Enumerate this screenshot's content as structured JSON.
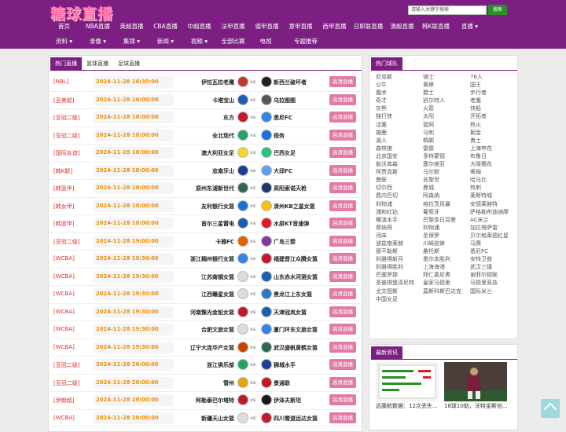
{
  "header": {
    "logo": "糖球直播",
    "search_placeholder": "请输入关键字搜索",
    "search_button": "搜索"
  },
  "nav1": [
    "首页",
    "NBA直播",
    "英超直播",
    "CBA直播",
    "中超直播",
    "法甲直播",
    "德甲直播",
    "意甲直播",
    "西甲直播",
    "日职联直播",
    "澳超直播",
    "韩K联直播",
    "直播 ▾"
  ],
  "nav2": [
    "资料 ▾",
    "录像 ▾",
    "集锦 ▾",
    "新闻 ▾",
    "视频 ▾",
    "全部比赛",
    "电视",
    "专题推荐"
  ],
  "tabs": [
    "热门直播",
    "篮球直播",
    "足球直播"
  ],
  "live_label": "高清直播",
  "vs": "vs",
  "matches": [
    {
      "league": "[NBL]",
      "time": "2024-11-28 16:30:00",
      "home": "伊拉瓦拉老鹰",
      "away": "新西兰破坏者",
      "hc": "#c0392b",
      "ac": "#222"
    },
    {
      "league": "[亚美超]",
      "time": "2024-11-28 16:00:00",
      "home": "卡塔宝山",
      "away": "乌拉图图",
      "hc": "#1a5fb4",
      "ac": "#555"
    },
    {
      "league": "[亚冠二级]",
      "time": "2024-11-28 18:00:00",
      "home": "东方",
      "away": "悉尼FC",
      "hc": "#c01c28",
      "ac": "#3584e4"
    },
    {
      "league": "[亚冠二级]",
      "time": "2024-11-28 18:00:00",
      "home": "全北现代",
      "away": "宿务",
      "hc": "#26a269",
      "ac": "#1c71d8"
    },
    {
      "league": "[国际友谊]",
      "time": "2024-11-28 18:00:00",
      "home": "澳大利亚女足",
      "away": "巴西女足",
      "hc": "#f6d32d",
      "ac": "#2ec27e"
    },
    {
      "league": "[韩K联]",
      "time": "2024-11-28 18:00:00",
      "home": "忠南牙山",
      "away": "大邱FC",
      "hc": "#1c3f94",
      "ac": "#62a0ea"
    },
    {
      "league": "[韩篮甲]",
      "time": "2024-11-28 18:00:00",
      "home": "原州东浦新世代",
      "away": "高阳索诺天枪",
      "hc": "#2d6a4f",
      "ac": "#1a3a6b"
    },
    {
      "league": "[韩女甲]",
      "time": "2024-11-28 18:00:00",
      "home": "友利银行女篮",
      "away": "清州KB之星女篮",
      "hc": "#1c71d8",
      "ac": "#f5c211"
    },
    {
      "league": "[韩篮甲]",
      "time": "2024-11-28 18:00:00",
      "home": "首尔三星雷电",
      "away": "水原KT音速弹",
      "hc": "#1a5fb4",
      "ac": "#e01b24"
    },
    {
      "league": "[亚冠二级]",
      "time": "2024-11-28 19:00:00",
      "home": "卡雅FC",
      "away": "广岛三箭",
      "hc": "#e66100",
      "ac": "#813d9c"
    },
    {
      "league": "[WCBA]",
      "time": "2024-11-28 19:30:00",
      "home": "浙江稠州银行女篮",
      "away": "福建晋江众腾女篮",
      "hc": "#3584e4",
      "ac": "#c01c28"
    },
    {
      "league": "[WCBA]",
      "time": "2024-11-28 19:30:00",
      "home": "江苏南钢女篮",
      "away": "山东赤水河酒女篮",
      "hc": "#dddddd",
      "ac": "#1a5fb4"
    },
    {
      "league": "[WCBA]",
      "time": "2024-11-28 19:30:00",
      "home": "江西赣星女篮",
      "away": "黑龙江上东女篮",
      "hc": "#dddddd",
      "ac": "#2a7ac8"
    },
    {
      "league": "[WCBA]",
      "time": "2024-11-28 19:30:00",
      "home": "河南豫光金铅女篮",
      "away": "天津冠岚女篮",
      "hc": "#c01c28",
      "ac": "#1a5fb4"
    },
    {
      "league": "[WCBA]",
      "time": "2024-11-28 19:30:00",
      "home": "合肥文旅女篮",
      "away": "厦门环东文旅女篮",
      "hc": "#dddddd",
      "ac": "#3584e4"
    },
    {
      "league": "[WCBA]",
      "time": "2024-11-28 19:30:00",
      "home": "辽宁大连华产女篮",
      "away": "武汉盛帆黄鹤女篮",
      "hc": "#c64600",
      "ac": "#2d6a4f"
    },
    {
      "league": "[亚冠二级]",
      "time": "2024-11-28 20:00:00",
      "home": "浙江俱乐部",
      "away": "狮城水手",
      "hc": "#26a269",
      "ac": "#1c3f94"
    },
    {
      "league": "[亚冠二级]",
      "time": "2024-11-28 20:00:00",
      "home": "雪州",
      "away": "景通联",
      "hc": "#e5a50a",
      "ac": "#c01c28"
    },
    {
      "league": "[伊朗超]",
      "time": "2024-11-28 20:00:00",
      "home": "阿勒泰巴尔塔特",
      "away": "伊泽夫斯坦",
      "hc": "#c01c28",
      "ac": "#1a1a1a"
    },
    {
      "league": "[WCBA]",
      "time": "2024-11-28 20:00:00",
      "home": "新疆天山女篮",
      "away": "四川蜀道远达女篮",
      "hc": "#dddddd",
      "ac": "#c01c28"
    }
  ],
  "sidebar": {
    "title": "热门球队",
    "teams": [
      "尼克斯",
      "骑士",
      "76人",
      "公牛",
      "黄蜂",
      "国王",
      "魔术",
      "爵士",
      "步行者",
      "奇才",
      "凯尔特人",
      "老鹰",
      "灰熊",
      "火箭",
      "快船",
      "独行侠",
      "太阳",
      "开拓者",
      "活塞",
      "篮网",
      "热火",
      "雄鹿",
      "马刺",
      "掘金",
      "湖人",
      "鹈鹕",
      "勇士",
      "森林狼",
      "雷霆",
      "上海申花",
      "北京国安",
      "多特蒙德",
      "布鲁日",
      "勒沃库森",
      "塞尔维亚",
      "大阪樱花",
      "阿贾克斯",
      "马尔默",
      "蒂姆",
      "曼联",
      "苏黎世",
      "哈马比",
      "切尔西",
      "曼城",
      "热刺",
      "费内巴切",
      "阿森纳",
      "莱斯特城",
      "利物浦",
      "格拉茨风暴",
      "安德莱赫特",
      "浦和红钻",
      "葡萄牙",
      "萨格勒布迪纳摩",
      "横滨水手",
      "巴黎圣日耳曼",
      "AC米兰",
      "摩纳哥",
      "利物浦",
      "加拉塔萨雷",
      "河床",
      "圣保罗",
      "贝尔格莱德红星",
      "波兹南莱赫",
      "川崎前锋",
      "马赛",
      "那不勒斯",
      "桑托斯",
      "悉尼FC",
      "利雅得新月",
      "墨尔本胜利",
      "安特卫普",
      "利雅得胜利",
      "上海海港",
      "武汉三镇",
      "巴塞罗那",
      "拜仁慕尼黑",
      "谢菲尔德联",
      "圣彼得堡泽尼特",
      "皇家马德里",
      "马德里竞技",
      "尤文图斯",
      "莫斯科斯巴达克",
      "国际米兰",
      "中国女足"
    ]
  },
  "news": {
    "title": "最新资讯",
    "items": [
      "远藤航数据：12次丢失...",
      "18球10助，沃特金斯创..."
    ]
  }
}
